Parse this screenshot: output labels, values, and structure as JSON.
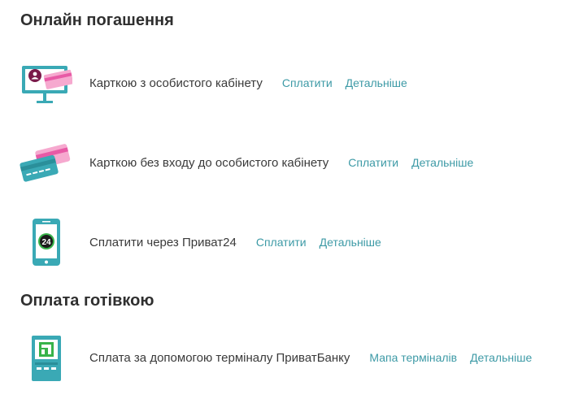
{
  "sections": [
    {
      "title": "Онлайн погашення",
      "items": [
        {
          "icon": "monitor-card-icon",
          "label": "Карткою з особистого кабінету",
          "links": [
            "Сплатити",
            "Детальніше"
          ]
        },
        {
          "icon": "cards-icon",
          "label": "Карткою без входу до особистого кабінету",
          "links": [
            "Сплатити",
            "Детальніше"
          ]
        },
        {
          "icon": "phone-privat24-icon",
          "label": "Сплатити через Приват24",
          "links": [
            "Сплатити",
            "Детальніше"
          ],
          "icon_text": "24"
        }
      ]
    },
    {
      "title": "Оплата готівкою",
      "items": [
        {
          "icon": "terminal-icon",
          "label": "Сплата за допомогою терміналу ПриватБанку",
          "links": [
            "Мапа терміналів",
            "Детальніше"
          ]
        }
      ]
    }
  ],
  "colors": {
    "teal": "#3aa9b5",
    "teal_dark": "#2a8f9a",
    "pink": "#e85aa6",
    "pink_light": "#f6a9cf",
    "link": "#3d9aa6"
  }
}
